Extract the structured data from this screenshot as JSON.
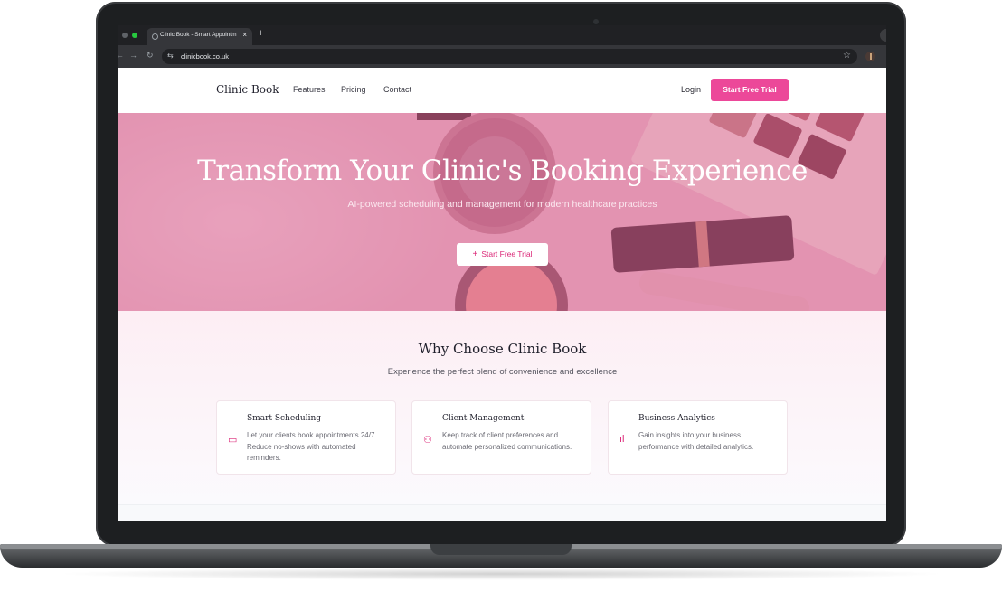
{
  "browser": {
    "tab_title": "Clinic Book - Smart Appointm",
    "tab_close": "×",
    "new_tab": "+",
    "back": "←",
    "forward": "→",
    "reload": "↻",
    "site_settings_icon": "⇆",
    "url": "clinicbook.co.uk",
    "bookmark_icon": "☆"
  },
  "header": {
    "logo": "Clinic Book",
    "nav": [
      "Features",
      "Pricing",
      "Contact"
    ],
    "login": "Login",
    "cta": "Start Free Trial"
  },
  "hero": {
    "title": "Transform Your Clinic's Booking Experience",
    "subtitle": "AI-powered scheduling and management for modern healthcare practices",
    "cta_icon": "+",
    "cta": "Start Free Trial"
  },
  "why": {
    "title": "Why Choose Clinic Book",
    "subtitle": "Experience the perfect blend of convenience and excellence",
    "features": [
      {
        "icon": "calendar-icon",
        "glyph": "▭",
        "title": "Smart Scheduling",
        "text": "Let your clients book appointments 24/7. Reduce no-shows with automated reminders."
      },
      {
        "icon": "users-icon",
        "glyph": "⚇",
        "title": "Client Management",
        "text": "Keep track of client preferences and automate personalized communications."
      },
      {
        "icon": "bar-chart-icon",
        "glyph": "ıl",
        "title": "Business Analytics",
        "text": "Gain insights into your business performance with detailed analytics."
      }
    ]
  },
  "colors": {
    "accent": "#ec4899",
    "hero_overlay": "#de6996",
    "browser_dark": "#202124"
  }
}
